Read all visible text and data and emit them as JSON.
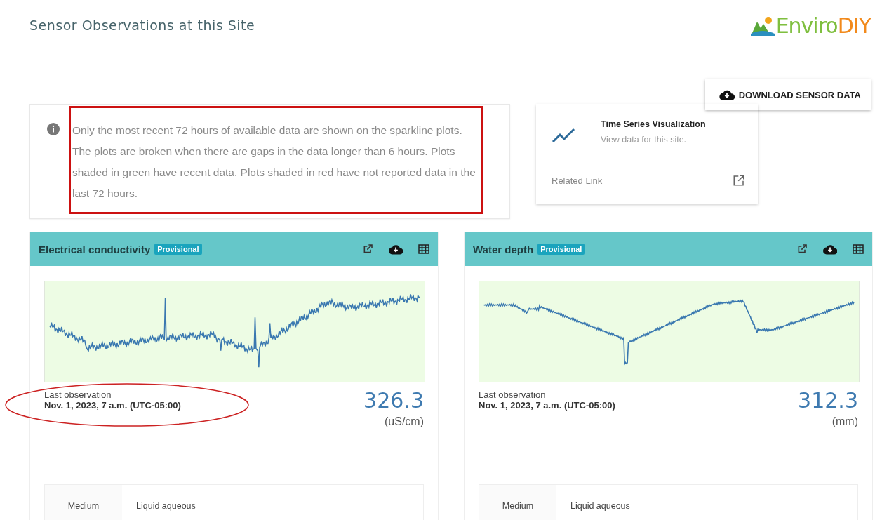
{
  "header": {
    "title": "Sensor Observations at this Site",
    "logo": {
      "part1": "Enviro",
      "part2": "DIY"
    }
  },
  "download_button": {
    "label": "DOWNLOAD SENSOR DATA"
  },
  "info": {
    "text": "Only the most recent 72 hours of available data are shown on the sparkline plots. The plots are broken when there are gaps in the data longer than 6 hours. Plots shaded in green have recent data. Plots shaded in red have not reported data in the last 72 hours.",
    "highlighted": true
  },
  "related_link": {
    "title": "Time Series Visualization",
    "subtitle": "View data for this site.",
    "label": "Related Link"
  },
  "sensors": [
    {
      "name": "Electrical conductivity",
      "badge": "Provisional",
      "recent": true,
      "last_label": "Last observation",
      "last_time": "Nov. 1, 2023, 7 a.m. (UTC-05:00)",
      "time_highlighted": true,
      "value": "326.3",
      "unit": "(uS/cm)",
      "details": [
        {
          "label": "Medium",
          "value": "Liquid aqueous"
        }
      ]
    },
    {
      "name": "Water depth",
      "badge": "Provisional",
      "recent": true,
      "last_label": "Last observation",
      "last_time": "Nov. 1, 2023, 7 a.m. (UTC-05:00)",
      "time_highlighted": false,
      "value": "312.3",
      "unit": "(mm)",
      "details": [
        {
          "label": "Medium",
          "value": "Liquid aqueous"
        }
      ]
    }
  ]
}
